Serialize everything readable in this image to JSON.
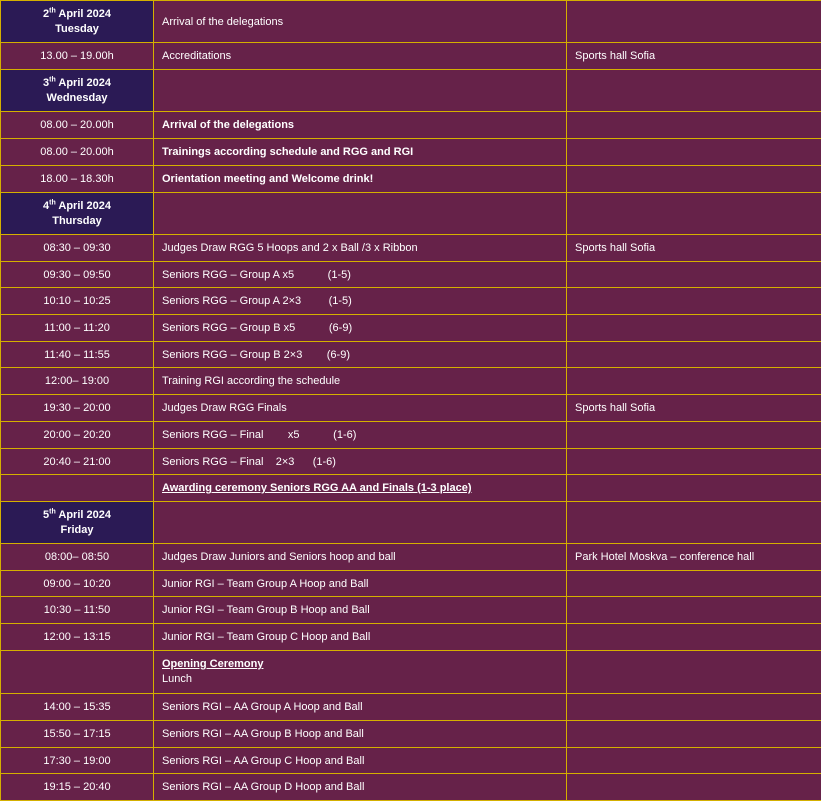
{
  "days": [
    {
      "date_num": "2",
      "suffix": "th",
      "date_rest": " April 2024",
      "weekday": "Tuesday",
      "event": "Arrival of the delegations"
    },
    {
      "date_num": "3",
      "suffix": "th",
      "date_rest": " April 2024",
      "weekday": "Wednesday"
    },
    {
      "date_num": "4",
      "suffix": "th",
      "date_rest": " April 2024",
      "weekday": "Thursday"
    },
    {
      "date_num": "5",
      "suffix": "th",
      "date_rest": " April 2024",
      "weekday": "Friday"
    }
  ],
  "rows": {
    "d1r1": {
      "time": "13.00 – 19.00h",
      "event": "Accreditations",
      "venue": "Sports hall Sofia"
    },
    "d2r1": {
      "time": "08.00 – 20.00h",
      "event": "Arrival of the delegations"
    },
    "d2r2": {
      "time": "08.00 – 20.00h",
      "event": "Trainings according schedule and RGG and RGI"
    },
    "d2r3": {
      "time": "18.00 – 18.30h",
      "event": "Orientation meeting and Welcome drink!"
    },
    "d3r1": {
      "time": "08:30 – 09:30",
      "event": "Judges Draw RGG 5 Hoops and 2 x Ball /3 x Ribbon",
      "venue": "Sports hall Sofia"
    },
    "d3r2": {
      "time": "09:30 – 09:50",
      "event": "Seniors RGG – Group A x5           (1-5)"
    },
    "d3r3": {
      "time": "10:10 – 10:25",
      "event": "Seniors RGG – Group A 2×3         (1-5)"
    },
    "d3r4": {
      "time": "11:00 – 11:20",
      "event": "Seniors RGG – Group B x5           (6-9)"
    },
    "d3r5": {
      "time": "11:40 – 11:55",
      "event": "Seniors RGG – Group B 2×3        (6-9)"
    },
    "d3r6": {
      "time": "12:00– 19:00",
      "event": "Training RGI according the schedule"
    },
    "d3r7": {
      "time": "19:30 – 20:00",
      "event": "Judges Draw RGG Finals",
      "venue": "Sports hall Sofia"
    },
    "d3r8": {
      "time": "20:00 – 20:20",
      "event": "Seniors RGG – Final        x5           (1-6)"
    },
    "d3r9": {
      "time": "20:40 – 21:00",
      "event": "Seniors RGG – Final    2×3      (1-6)"
    },
    "d3r10": {
      "event": "Awarding ceremony Seniors RGG AA and Finals (1-3 place)"
    },
    "d4r1": {
      "time": "08:00– 08:50",
      "event": "Judges Draw Juniors and Seniors hoop and ball",
      "venue": "Park Hotel Moskva – conference hall"
    },
    "d4r2": {
      "time": "09:00 – 10:20",
      "event": "Junior RGI – Team Group A Hoop and Ball"
    },
    "d4r3": {
      "time": "10:30 – 11:50",
      "event": "Junior RGI – Team Group B Hoop and Ball"
    },
    "d4r4": {
      "time": "12:00 – 13:15",
      "event": "Junior RGI – Team Group C Hoop and Ball"
    },
    "d4r5": {
      "event": "Opening Ceremony",
      "event2": "Lunch"
    },
    "d4r6": {
      "time": "14:00 – 15:35",
      "event": "Seniors RGI – AA Group A Hoop and Ball"
    },
    "d4r7": {
      "time": "15:50 – 17:15",
      "event": "Seniors RGI – AA Group B Hoop and Ball"
    },
    "d4r8": {
      "time": "17:30 – 19:00",
      "event": "Seniors RGI – AA Group C Hoop and Ball"
    },
    "d4r9": {
      "time": "19:15 – 20:40",
      "event": "Seniors RGI – AA Group D Hoop and Ball"
    }
  },
  "colors": {
    "background": "#662249",
    "day_header": "#2b1a55",
    "border": "#d4b000",
    "text": "#ffffff"
  }
}
